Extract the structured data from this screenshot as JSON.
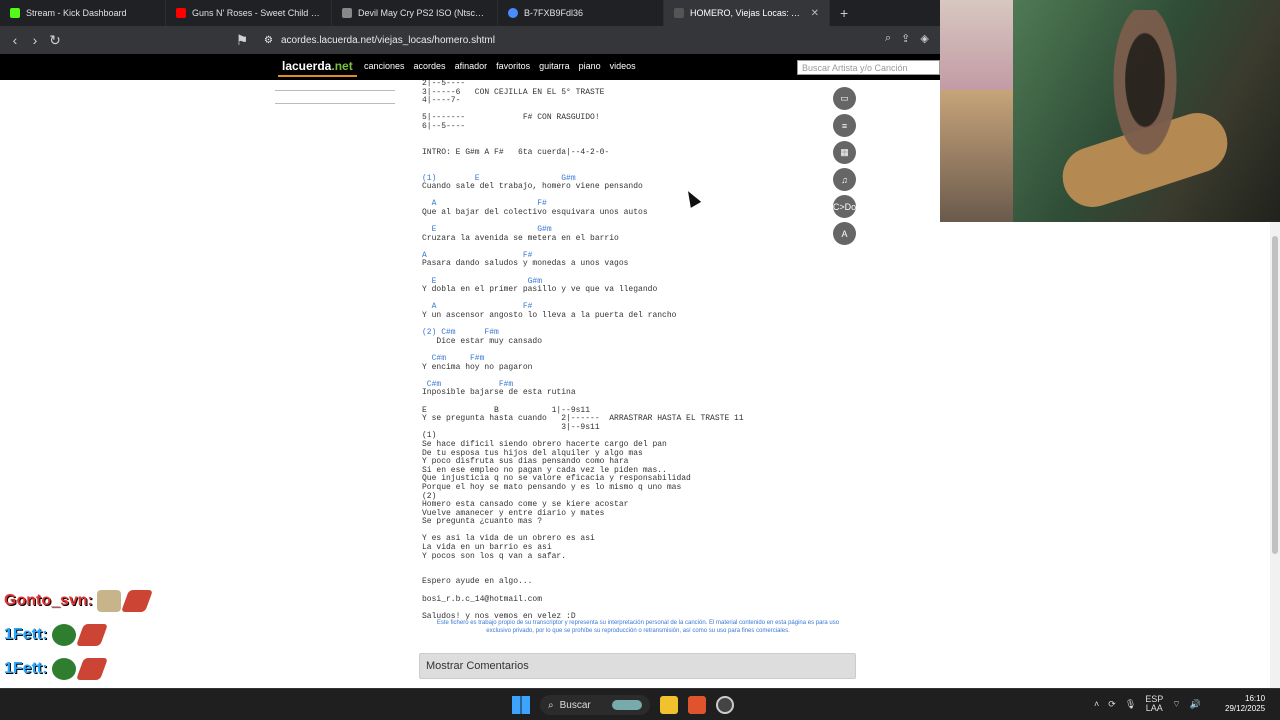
{
  "browser": {
    "tabs": [
      {
        "label": "Stream - Kick Dashboard",
        "color": "#53fc18"
      },
      {
        "label": "Guns N' Roses - Sweet Child O' Mine",
        "color": "#ff0000"
      },
      {
        "label": "Devil May Cry PS2 ISO (Ntsc-Pal) (Es)",
        "color": "#888888"
      },
      {
        "label": "B-7FXB9Fdl36",
        "color": "#4a8cff"
      },
      {
        "label": "HOMERO, Viejas Locas: Acordes",
        "color": "#333333"
      }
    ],
    "new_tab": "+",
    "close_tab": "✕",
    "url": "acordes.lacuerda.net/viejas_locas/homero.shtml"
  },
  "site": {
    "logo_main": "lacuerda",
    "logo_suffix": ".net",
    "nav": [
      "canciones",
      "acordes",
      "afinador",
      "favoritos",
      "guitarra",
      "piano",
      "videos"
    ],
    "search_placeholder": "Buscar Artista y/o Canción"
  },
  "song_lines": [
    {
      "t": "2|--5----",
      "c": false
    },
    {
      "t": "3|-----6   CON CEJILLA EN EL 5° TRASTE",
      "c": false
    },
    {
      "t": "4|----7-",
      "c": false
    },
    {
      "t": "",
      "c": false
    },
    {
      "t": "5|-------            F# CON RASGUIDO!",
      "c": false
    },
    {
      "t": "6|--5----",
      "c": false
    },
    {
      "t": "",
      "c": false
    },
    {
      "t": "",
      "c": false
    },
    {
      "t": "INTRO: E G#m A F#   6ta cuerda|--4-2-0-",
      "c": false
    },
    {
      "t": "",
      "c": false
    },
    {
      "t": "",
      "c": false
    },
    {
      "t": "(1)        E                 G#m",
      "c": true
    },
    {
      "t": "Cuando sale del trabajo, homero viene pensando",
      "c": false
    },
    {
      "t": "",
      "c": false
    },
    {
      "t": "  A                     F#",
      "c": true
    },
    {
      "t": "Que al bajar del colectivo esquivara unos autos",
      "c": false
    },
    {
      "t": "",
      "c": false
    },
    {
      "t": "  E                     G#m",
      "c": true
    },
    {
      "t": "Cruzara la avenida se metera en el barrio",
      "c": false
    },
    {
      "t": "",
      "c": false
    },
    {
      "t": "A                    F#",
      "c": true
    },
    {
      "t": "Pasara dando saludos y monedas a unos vagos",
      "c": false
    },
    {
      "t": "",
      "c": false
    },
    {
      "t": "  E                   G#m",
      "c": true
    },
    {
      "t": "Y dobla en el primer pasillo y ve que va llegando",
      "c": false
    },
    {
      "t": "",
      "c": false
    },
    {
      "t": "  A                  F#",
      "c": true
    },
    {
      "t": "Y un ascensor angosto lo lleva a la puerta del rancho",
      "c": false
    },
    {
      "t": "",
      "c": false
    },
    {
      "t": "(2) C#m      F#m",
      "c": true
    },
    {
      "t": "   Dice estar muy cansado",
      "c": false
    },
    {
      "t": "",
      "c": false
    },
    {
      "t": "  C#m     F#m",
      "c": true
    },
    {
      "t": "Y encima hoy no pagaron",
      "c": false
    },
    {
      "t": "",
      "c": false
    },
    {
      "t": " C#m            F#m",
      "c": true
    },
    {
      "t": "Inposible bajarse de esta rutina",
      "c": false
    },
    {
      "t": "",
      "c": false
    },
    {
      "t": "E              B           1|--9s11",
      "c": false
    },
    {
      "t": "Y se pregunta hasta cuando   2|------  ARRASTRAR HASTA EL TRASTE 11",
      "c": false
    },
    {
      "t": "                             3|--9s11",
      "c": false
    },
    {
      "t": "(1)",
      "c": false
    },
    {
      "t": "Se hace dificil siendo obrero hacerte cargo del pan",
      "c": false
    },
    {
      "t": "De tu esposa tus hijos del alquiler y algo mas",
      "c": false
    },
    {
      "t": "Y poco disfruta sus dias pensando como hara",
      "c": false
    },
    {
      "t": "Si en ese empleo no pagan y cada vez le piden mas..",
      "c": false
    },
    {
      "t": "Que injusticia q no se valore eficacia y responsabilidad",
      "c": false
    },
    {
      "t": "Porque el hoy se mato pensando y es lo mismo q uno mas",
      "c": false
    },
    {
      "t": "(2)",
      "c": false
    },
    {
      "t": "Homero esta cansado come y se kiere acostar",
      "c": false
    },
    {
      "t": "Vuelve amanecer y entre diario y mates",
      "c": false
    },
    {
      "t": "Se pregunta ¿cuanto mas ?",
      "c": false
    },
    {
      "t": "",
      "c": false
    },
    {
      "t": "Y es asi la vida de un obrero es asi",
      "c": false
    },
    {
      "t": "La vida en un barrio es asi",
      "c": false
    },
    {
      "t": "Y pocos son los q van a safar.",
      "c": false
    },
    {
      "t": "",
      "c": false
    },
    {
      "t": "",
      "c": false
    },
    {
      "t": "Espero ayude en algo...",
      "c": false
    },
    {
      "t": "",
      "c": false
    },
    {
      "t": "bosi_r.b.c_14@hotmail.com",
      "c": false
    },
    {
      "t": "",
      "c": false
    },
    {
      "t": "Saludos! y nos vemos en velez :D",
      "c": false
    }
  ],
  "disclaimer": "Este fichero es trabajo propio de su transcriptor y representa su interpretación personal de la canción. El material contenido en esta página es para uso exclusivo privado, por lo que se prohíbe su reproducción o retransmisión, así como su uso para fines comerciales.",
  "comments_button": "Mostrar Comentarios",
  "side_tools": [
    "print-icon",
    "list-icon",
    "grid-icon",
    "tuning-icon",
    "c-do-icon",
    "font-size-icon"
  ],
  "side_tools_text": [
    "▭",
    "≡",
    "▦",
    "♫",
    "C>Do",
    "A"
  ],
  "chat": [
    {
      "name": "Gonto_svn:",
      "color": "#e33333"
    },
    {
      "name": "1Fett:",
      "color": "#2aa7ff"
    },
    {
      "name": "1Fett:",
      "color": "#2aa7ff"
    },
    {
      "name": "1Fett:",
      "color": "#2aa7ff"
    }
  ],
  "taskbar": {
    "search": "Buscar",
    "lang": "ESP",
    "lang2": "LAA",
    "time": "16:10",
    "date": "29/12/2025"
  }
}
